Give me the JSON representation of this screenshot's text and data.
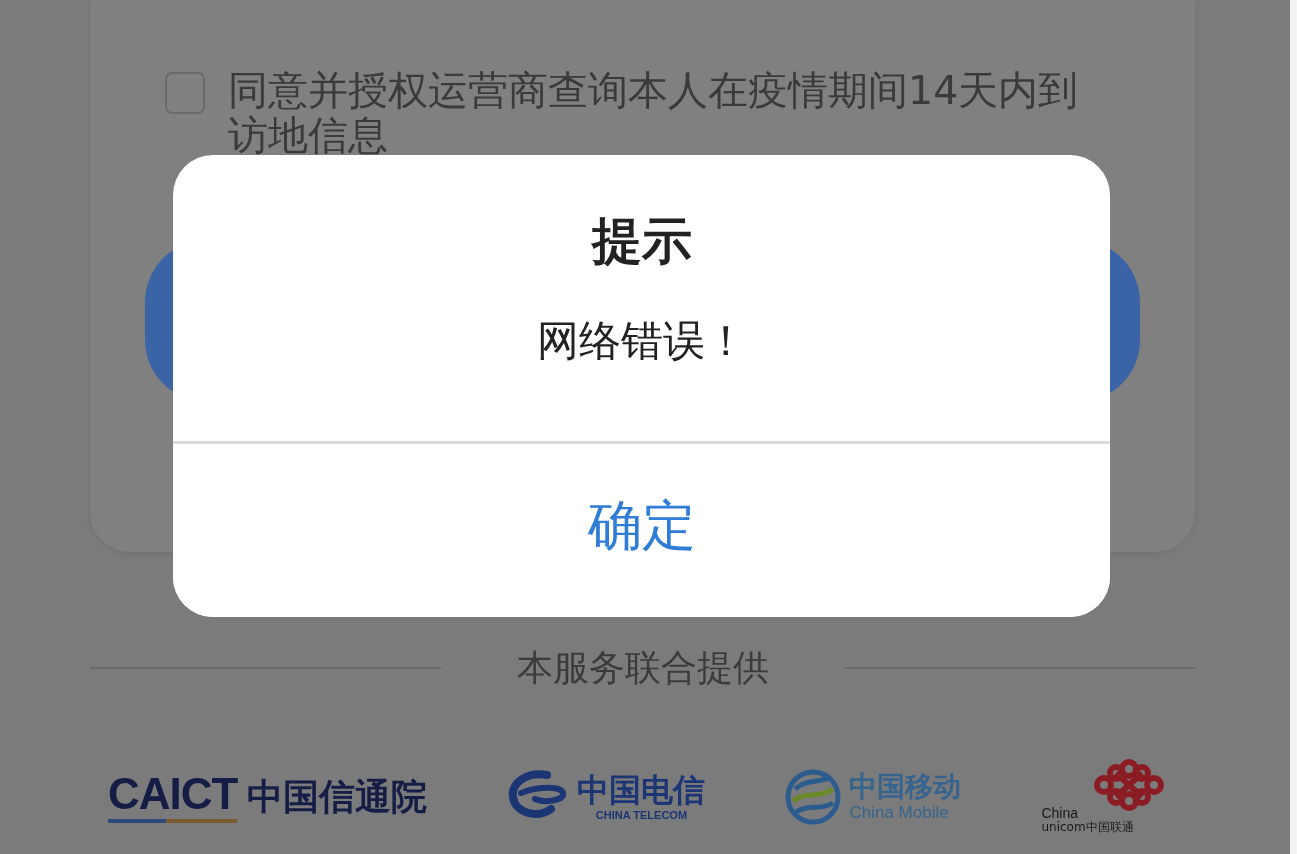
{
  "agreement": {
    "checked": false,
    "text": "同意并授权运营商查询本人在疫情期间14天内到访地信息"
  },
  "dialog": {
    "title": "提示",
    "message": "网络错误！",
    "confirm": "确定"
  },
  "partners": {
    "caption": "本服务联合提供",
    "logos": [
      {
        "kind": "caict",
        "texts": [
          "CAICT",
          "中国信通院"
        ]
      },
      {
        "kind": "telecom",
        "texts": [
          "中国电信",
          "CHINA TELECOM"
        ]
      },
      {
        "kind": "mobile",
        "texts": [
          "中国移动",
          "China Mobile"
        ]
      },
      {
        "kind": "unicom",
        "texts": [
          "China",
          "unicom中国联通"
        ]
      }
    ]
  }
}
